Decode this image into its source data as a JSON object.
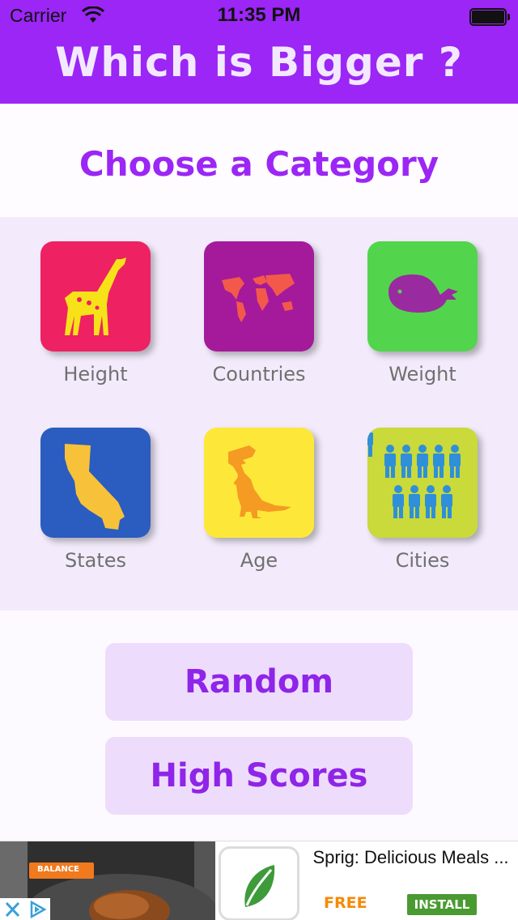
{
  "status_bar": {
    "carrier": "Carrier",
    "time": "11:35 PM"
  },
  "header": {
    "title": "Which is Bigger ?"
  },
  "categories": {
    "heading": "Choose a Category",
    "items": [
      {
        "label": "Height",
        "icon": "giraffe-icon",
        "color": "#ee2162"
      },
      {
        "label": "Countries",
        "icon": "world-map-icon",
        "color": "#a41a9b"
      },
      {
        "label": "Weight",
        "icon": "whale-icon",
        "color": "#52d54c"
      },
      {
        "label": "States",
        "icon": "california-icon",
        "color": "#2b5cc0"
      },
      {
        "label": "Age",
        "icon": "dinosaur-icon",
        "color": "#fde83a"
      },
      {
        "label": "Cities",
        "icon": "people-icon",
        "color": "#c9da3a"
      }
    ]
  },
  "buttons": {
    "random": "Random",
    "high_scores": "High Scores"
  },
  "ad": {
    "brand_badge": "BALANCE",
    "title": "Sprig: Delicious Meals ...",
    "price": "FREE",
    "install": "INSTALL"
  },
  "colors": {
    "accent": "#9b26f5",
    "button_bg": "#eedcfc"
  }
}
